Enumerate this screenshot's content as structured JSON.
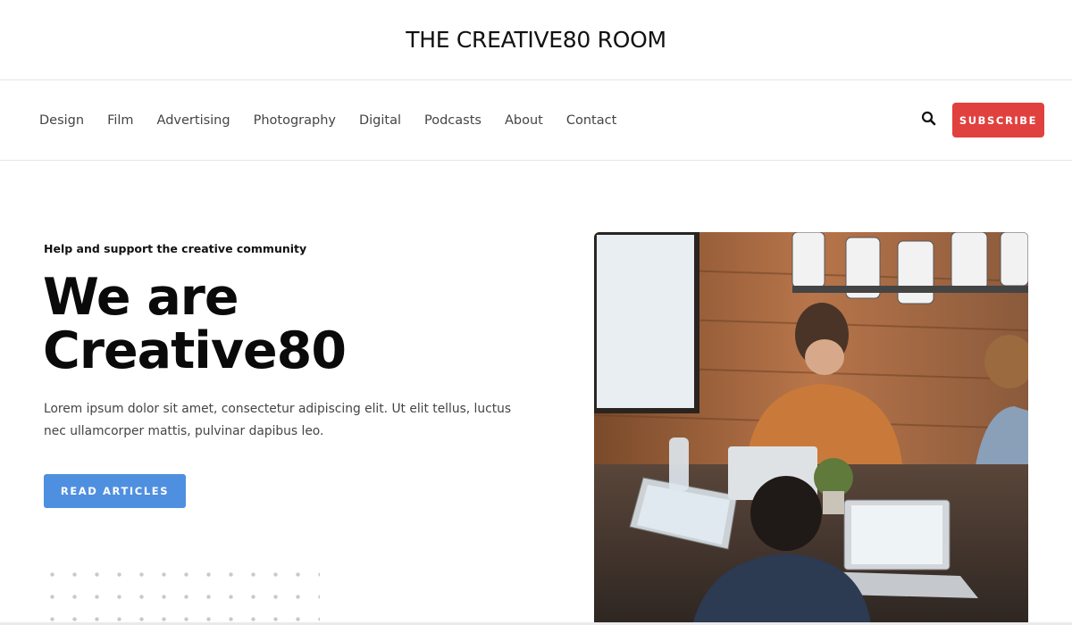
{
  "site": {
    "title": "THE CREATIVE80 ROOM"
  },
  "nav": {
    "items": [
      {
        "label": "Design"
      },
      {
        "label": "Film"
      },
      {
        "label": "Advertising"
      },
      {
        "label": "Photography"
      },
      {
        "label": "Digital"
      },
      {
        "label": "Podcasts"
      },
      {
        "label": "About"
      },
      {
        "label": "Contact"
      }
    ],
    "search_icon": "search-icon",
    "subscribe_label": "SUBSCRIBE",
    "subscribe_color": "#e0413f"
  },
  "hero": {
    "eyebrow": "Help and support the creative community",
    "title_line1": "We are",
    "title_line2": "Creative80",
    "description": "Lorem ipsum dolor sit amet, consectetur adipiscing elit. Ut elit tellus, luctus nec ullamcorper mattis, pulvinar dapibus leo.",
    "cta_label": "READ ARTICLES",
    "cta_color": "#4e8fe0",
    "image_subject": "people working on laptops at a table"
  }
}
